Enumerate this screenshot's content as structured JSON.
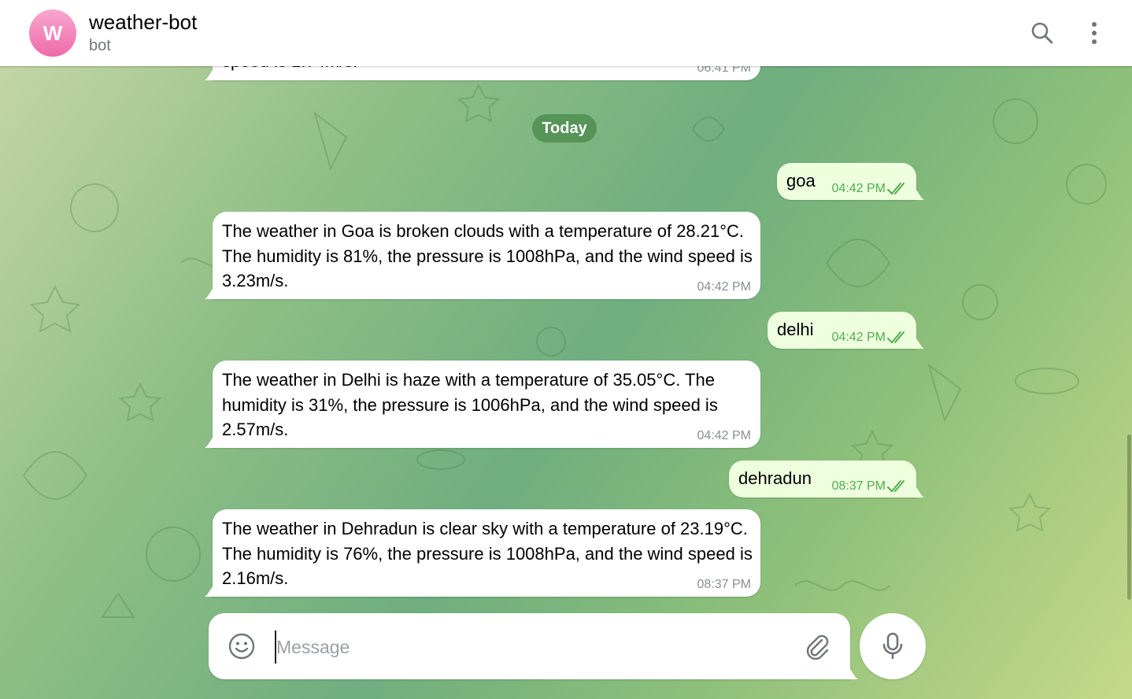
{
  "header": {
    "avatar_letter": "W",
    "title": "weather-bot",
    "subtitle": "bot"
  },
  "date_separator": "Today",
  "messages": [
    {
      "direction": "incoming",
      "text": "speed is 1.74m/s.",
      "time": "06:41 PM"
    },
    {
      "direction": "outgoing",
      "text": "goa",
      "time": "04:42 PM",
      "status": "read"
    },
    {
      "direction": "incoming",
      "text": "The weather in Goa is broken clouds with a temperature of 28.21°C. The humidity is 81%, the pressure is 1008hPa, and the wind speed is 3.23m/s.",
      "time": "04:42 PM"
    },
    {
      "direction": "outgoing",
      "text": "delhi",
      "time": "04:42 PM",
      "status": "read"
    },
    {
      "direction": "incoming",
      "text": "The weather in Delhi is haze with a temperature of 35.05°C. The humidity is 31%, the pressure is 1006hPa, and the wind speed is 2.57m/s.",
      "time": "04:42 PM"
    },
    {
      "direction": "outgoing",
      "text": "dehradun",
      "time": "08:37 PM",
      "status": "read"
    },
    {
      "direction": "incoming",
      "text": "The weather in Dehradun is clear sky with a temperature of 23.19°C. The humidity is 76%, the pressure is 1008hPa, and the wind speed is 2.16m/s.",
      "time": "08:37 PM"
    }
  ],
  "composer": {
    "placeholder": "Message"
  },
  "colors": {
    "avatar_gradient_top": "#f7a8cf",
    "avatar_gradient_bottom": "#ee6aa7",
    "outgoing_bubble": "#eeffde",
    "read_check": "#4fae4e",
    "date_pill": "#4a884a"
  },
  "icons": {
    "search": "search-icon",
    "more": "more-vertical-icon",
    "emoji": "emoji-icon",
    "attach": "paperclip-icon",
    "mic": "microphone-icon",
    "read_status": "double-check-icon"
  }
}
